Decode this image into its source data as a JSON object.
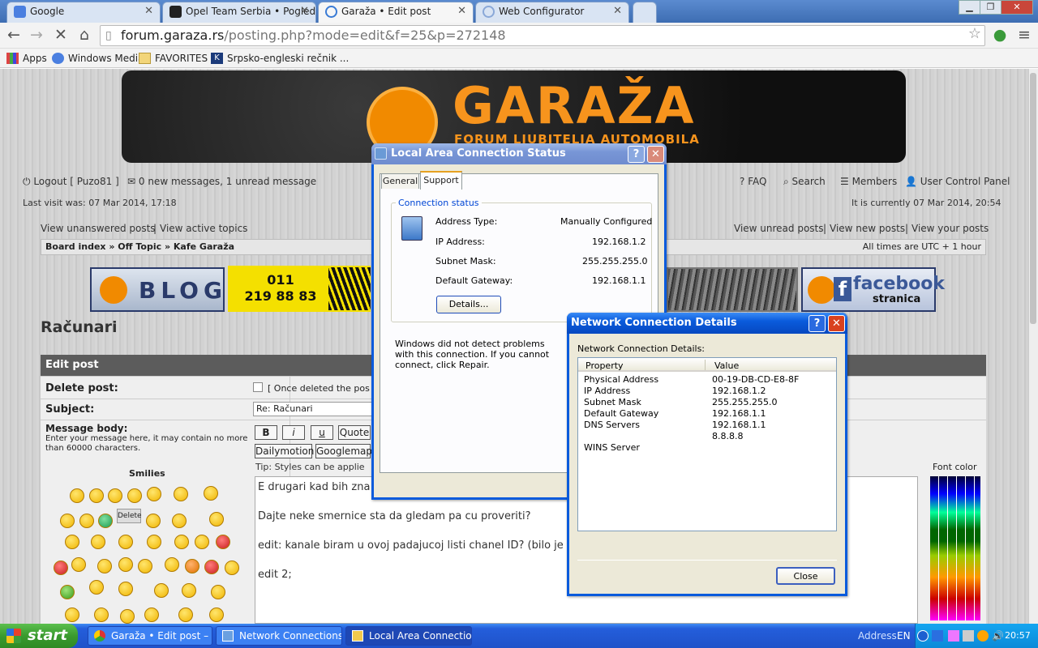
{
  "browser": {
    "tabs": [
      {
        "label": "Google"
      },
      {
        "label": "Opel Team Serbia • Pogledaj"
      },
      {
        "label": "Garaža • Edit post"
      },
      {
        "label": "Web Configurator"
      }
    ],
    "url_host": "forum.garaza.rs",
    "url_path": "/posting.php?mode=edit&f=25&p=272148",
    "bookmarks": [
      "Apps",
      "Windows Media",
      "FAVORITES",
      "Srpsko-engleski rečnik ..."
    ]
  },
  "forum": {
    "logo_text": "GARAŽA",
    "logo_sub": "FORUM LJUBITELJA AUTOMOBILA",
    "logout": "Logout [ Puzo81 ]",
    "messages": "0 new messages, 1 unread message",
    "faq": "FAQ",
    "search": "Search",
    "members": "Members",
    "ucp": "User Control Panel",
    "last_visit": "Last visit was: 07 Mar 2014, 17:18",
    "current_time": "It is currently 07 Mar 2014, 20:54",
    "view_unanswered": "View unanswered posts",
    "view_active": "View active topics",
    "view_unread": "View unread posts",
    "view_new": "View new posts",
    "view_yours": "View your posts",
    "breadcrumb": "Board index » Off Topic » Kafe Garaža",
    "timezone": "All times are UTC + 1 hour",
    "ad_blog": "BLOG",
    "ad_phone": "011\n219 88 83",
    "ad_facebook": "facebook",
    "ad_facebook_sub": "stranica",
    "page_title": "Računari"
  },
  "post_form": {
    "header": "Edit post",
    "delete_label": "Delete post:",
    "delete_note": "[ Once deleted the pos",
    "subject_label": "Subject:",
    "subject_value": "Re: Računari",
    "body_label": "Message body:",
    "body_help": "Enter your message here, it may contain no more than 60000 characters.",
    "smilies_label": "Smilies",
    "btn_bold": "B",
    "btn_italic": "i",
    "btn_underline": "u",
    "btn_quote": "Quote",
    "btn_dailymotion": "Dailymotion",
    "btn_googlemaps": "Googlemap",
    "tip": "Tip: Styles can be applie",
    "font_color": "Font color",
    "delete_tooltip": "Delete",
    "body_lines": [
      "E drugari kad bih zna",
      "Dajte neke smernice sta da gledam pa cu proveriti?",
      "edit: kanale biram u ovoj padajucoj listi chanel ID? (bilo je",
      "edit 2;"
    ]
  },
  "lan_status": {
    "title": "Local Area Connection  Status",
    "tab_general": "General",
    "tab_support": "Support",
    "group": "Connection status",
    "rows": [
      {
        "label": "Address Type:",
        "value": "Manually Configured"
      },
      {
        "label": "IP Address:",
        "value": "192.168.1.2"
      },
      {
        "label": "Subnet Mask:",
        "value": "255.255.255.0"
      },
      {
        "label": "Default Gateway:",
        "value": "192.168.1.1"
      }
    ],
    "details_btn": "Details...",
    "message": "Windows did not detect problems with this connection. If you cannot connect, click Repair."
  },
  "details": {
    "title": "Network Connection Details",
    "label": "Network Connection Details:",
    "col_property": "Property",
    "col_value": "Value",
    "rows": [
      {
        "property": "Physical Address",
        "value": "00-19-DB-CD-E8-8F"
      },
      {
        "property": "IP Address",
        "value": "192.168.1.2"
      },
      {
        "property": "Subnet Mask",
        "value": "255.255.255.0"
      },
      {
        "property": "Default Gateway",
        "value": "192.168.1.1"
      },
      {
        "property": "DNS Servers",
        "value": "192.168.1.1"
      },
      {
        "property": "",
        "value": "8.8.8.8"
      },
      {
        "property": "WINS Server",
        "value": ""
      }
    ],
    "close_btn": "Close"
  },
  "taskbar": {
    "start": "start",
    "items": [
      "Garaža • Edit post – ...",
      "Network Connections",
      "Local Area Connectio..."
    ],
    "address": "Address",
    "lang": "EN",
    "clock": "20:57"
  }
}
